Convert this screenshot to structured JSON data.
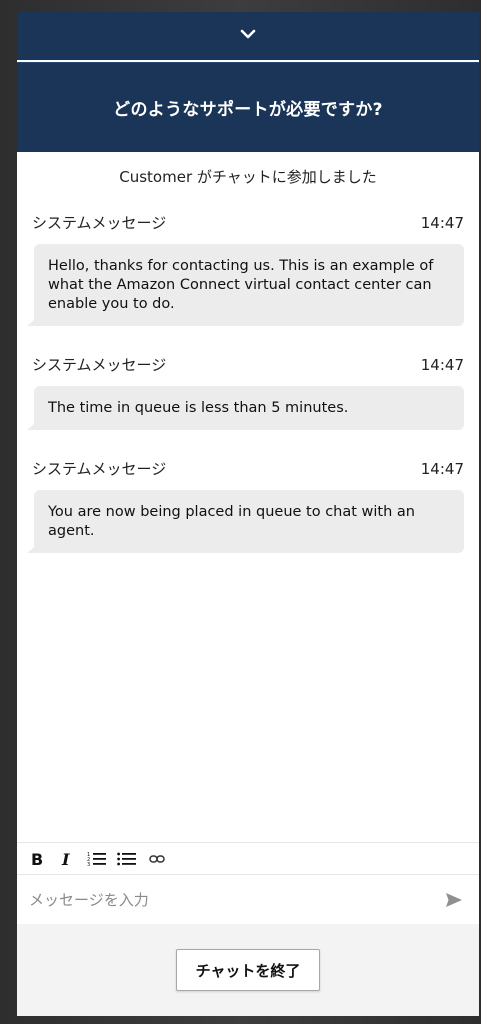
{
  "header": {
    "title": "どのようなサポートが必要ですか?"
  },
  "collapse": {
    "icon": "chevron-down-icon"
  },
  "transcript": {
    "join_notice": "Customer がチャットに参加しました",
    "messages": [
      {
        "sender": "システムメッセージ",
        "time": "14:47",
        "text": "Hello, thanks for contacting us. This is an example of what the Amazon Connect virtual contact center can enable you to do."
      },
      {
        "sender": "システムメッセージ",
        "time": "14:47",
        "text": "The time in queue is less than 5 minutes."
      },
      {
        "sender": "システムメッセージ",
        "time": "14:47",
        "text": "You are now being placed in queue to chat with an agent."
      }
    ]
  },
  "toolbar": {
    "icons": [
      "bold-icon",
      "italic-icon",
      "numbered-list-icon",
      "bulleted-list-icon",
      "link-icon"
    ]
  },
  "composer": {
    "placeholder": "メッセージを入力",
    "value": "",
    "send_icon": "send-icon"
  },
  "footer": {
    "end_chat_label": "チャットを終了"
  },
  "colors": {
    "header_bg": "#1a3557",
    "bubble_bg": "#ececec",
    "footer_bg": "#f3f3f3"
  }
}
